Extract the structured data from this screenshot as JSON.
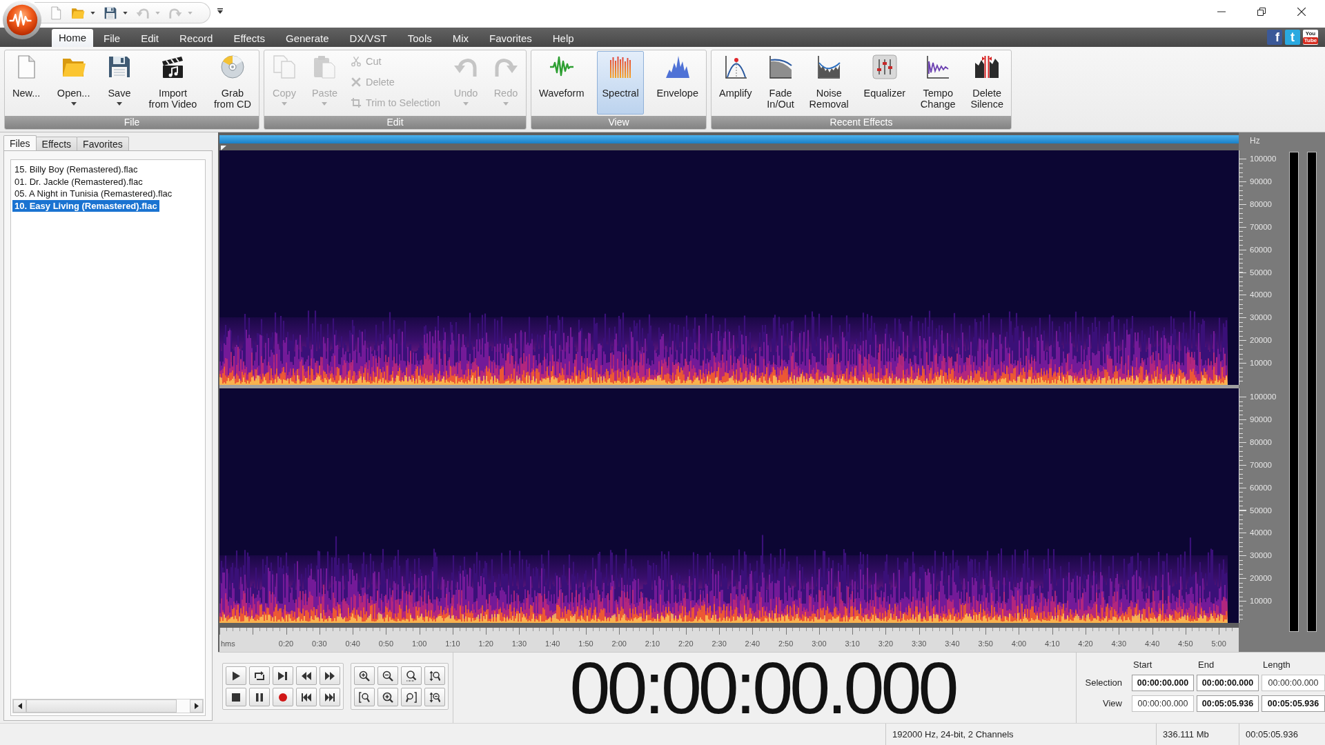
{
  "quick_access": [
    {
      "kind": "new",
      "dropdown": false,
      "disabled": false
    },
    {
      "kind": "open",
      "dropdown": true,
      "disabled": false
    },
    {
      "kind": "save",
      "dropdown": true,
      "disabled": false
    },
    {
      "kind": "undo",
      "dropdown": true,
      "disabled": true
    },
    {
      "kind": "redo",
      "dropdown": true,
      "disabled": true
    }
  ],
  "menu_tabs": [
    {
      "label": "Home",
      "selected": true
    },
    {
      "label": "File",
      "selected": false
    },
    {
      "label": "Edit",
      "selected": false
    },
    {
      "label": "Record",
      "selected": false
    },
    {
      "label": "Effects",
      "selected": false
    },
    {
      "label": "Generate",
      "selected": false
    },
    {
      "label": "DX/VST",
      "selected": false
    },
    {
      "label": "Tools",
      "selected": false
    },
    {
      "label": "Mix",
      "selected": false
    },
    {
      "label": "Favorites",
      "selected": false
    },
    {
      "label": "Help",
      "selected": false
    }
  ],
  "social_links": [
    {
      "kind": "facebook",
      "lines": [
        "f"
      ]
    },
    {
      "kind": "twitter",
      "lines": [
        "t"
      ]
    },
    {
      "kind": "youtube",
      "lines": [
        "You",
        "Tube"
      ]
    }
  ],
  "ribbon": {
    "groups": [
      {
        "title": "File",
        "buttons": [
          {
            "label": "New...",
            "kind": "new",
            "dropdown": false,
            "disabled": false
          },
          {
            "label": "Open...",
            "kind": "open",
            "dropdown": true,
            "disabled": false
          },
          {
            "label": "Save",
            "kind": "save",
            "dropdown": true,
            "disabled": false
          },
          {
            "label": "Import\nfrom Video",
            "kind": "import-video",
            "dropdown": false,
            "disabled": false
          },
          {
            "label": "Grab\nfrom CD",
            "kind": "grab-cd",
            "dropdown": false,
            "disabled": false
          }
        ]
      },
      {
        "title": "Edit",
        "buttons": [
          {
            "label": "Copy",
            "kind": "copy",
            "dropdown": true,
            "disabled": true
          },
          {
            "label": "Paste",
            "kind": "paste",
            "dropdown": true,
            "disabled": true
          },
          {
            "kind": "stack",
            "buttons": [
              {
                "label": "Cut",
                "kind": "cut",
                "dropdown": false,
                "disabled": true
              },
              {
                "label": "Delete",
                "kind": "delete",
                "dropdown": false,
                "disabled": true
              },
              {
                "label": "Trim to Selection",
                "kind": "trim",
                "dropdown": false,
                "disabled": true
              }
            ]
          },
          {
            "label": "Undo",
            "kind": "undo",
            "dropdown": true,
            "disabled": true
          },
          {
            "label": "Redo",
            "kind": "redo",
            "dropdown": true,
            "disabled": true
          }
        ]
      },
      {
        "title": "View",
        "buttons": [
          {
            "label": "Waveform",
            "kind": "waveform",
            "dropdown": false,
            "disabled": false,
            "selected": false
          },
          {
            "label": "Spectral",
            "kind": "spectral",
            "dropdown": false,
            "disabled": false,
            "selected": true
          },
          {
            "label": "Envelope",
            "kind": "envelope",
            "dropdown": false,
            "disabled": false,
            "selected": false
          }
        ]
      },
      {
        "title": "Recent Effects",
        "buttons": [
          {
            "label": "Amplify",
            "kind": "amplify",
            "dropdown": false,
            "disabled": false
          },
          {
            "label": "Fade\nIn/Out",
            "kind": "fade",
            "dropdown": false,
            "disabled": false
          },
          {
            "label": "Noise\nRemoval",
            "kind": "noise",
            "dropdown": false,
            "disabled": false
          },
          {
            "label": "Equalizer",
            "kind": "equalizer",
            "dropdown": false,
            "disabled": false
          },
          {
            "label": "Tempo\nChange",
            "kind": "tempo",
            "dropdown": false,
            "disabled": false
          },
          {
            "label": "Delete\nSilence",
            "kind": "silence",
            "dropdown": false,
            "disabled": false
          }
        ]
      }
    ]
  },
  "left_panel": {
    "tabs": [
      {
        "label": "Files",
        "selected": true
      },
      {
        "label": "Effects",
        "selected": false
      },
      {
        "label": "Favorites",
        "selected": false
      }
    ],
    "files": [
      {
        "name": "15. Billy Boy (Remastered).flac",
        "selected": false
      },
      {
        "name": "01. Dr. Jackle (Remastered).flac",
        "selected": false
      },
      {
        "name": "05. A Night in Tunisia (Remastered).flac",
        "selected": false
      },
      {
        "name": "10. Easy Living (Remastered).flac",
        "selected": true
      }
    ]
  },
  "editor": {
    "frequency_unit": "Hz",
    "channels": [
      {
        "frequency_labels": [
          "100000",
          "90000",
          "80000",
          "70000",
          "60000",
          "50000",
          "40000",
          "30000",
          "20000",
          "10000"
        ]
      },
      {
        "frequency_labels": [
          "100000",
          "90000",
          "80000",
          "70000",
          "60000",
          "50000",
          "40000",
          "30000",
          "20000",
          "10000"
        ]
      }
    ],
    "time_unit": "hms",
    "time_labels": [
      "0:20",
      "0:30",
      "0:40",
      "0:50",
      "1:00",
      "1:10",
      "1:20",
      "1:30",
      "1:40",
      "1:50",
      "2:00",
      "2:10",
      "2:20",
      "2:30",
      "2:40",
      "2:50",
      "3:00",
      "3:10",
      "3:20",
      "3:30",
      "3:40",
      "3:50",
      "4:00",
      "4:10",
      "4:20",
      "4:30",
      "4:40",
      "4:50",
      "5:00"
    ]
  },
  "time_display": "00:00:00.000",
  "selection_panel": {
    "columns": [
      "Start",
      "End",
      "Length"
    ],
    "rows": [
      {
        "label": "Selection",
        "fields": [
          {
            "value": "00:00:00.000",
            "highlighted": true
          },
          {
            "value": "00:00:00.000",
            "highlighted": true
          },
          {
            "value": "00:00:00.000",
            "highlighted": false
          }
        ]
      },
      {
        "label": "View",
        "fields": [
          {
            "value": "00:00:00.000",
            "highlighted": false
          },
          {
            "value": "00:05:05.936",
            "highlighted": true
          },
          {
            "value": "00:05:05.936",
            "highlighted": true
          }
        ]
      }
    ]
  },
  "status_bar": [
    "192000 Hz, 24-bit, 2 Channels",
    "336.111 Mb",
    "00:05:05.936"
  ]
}
